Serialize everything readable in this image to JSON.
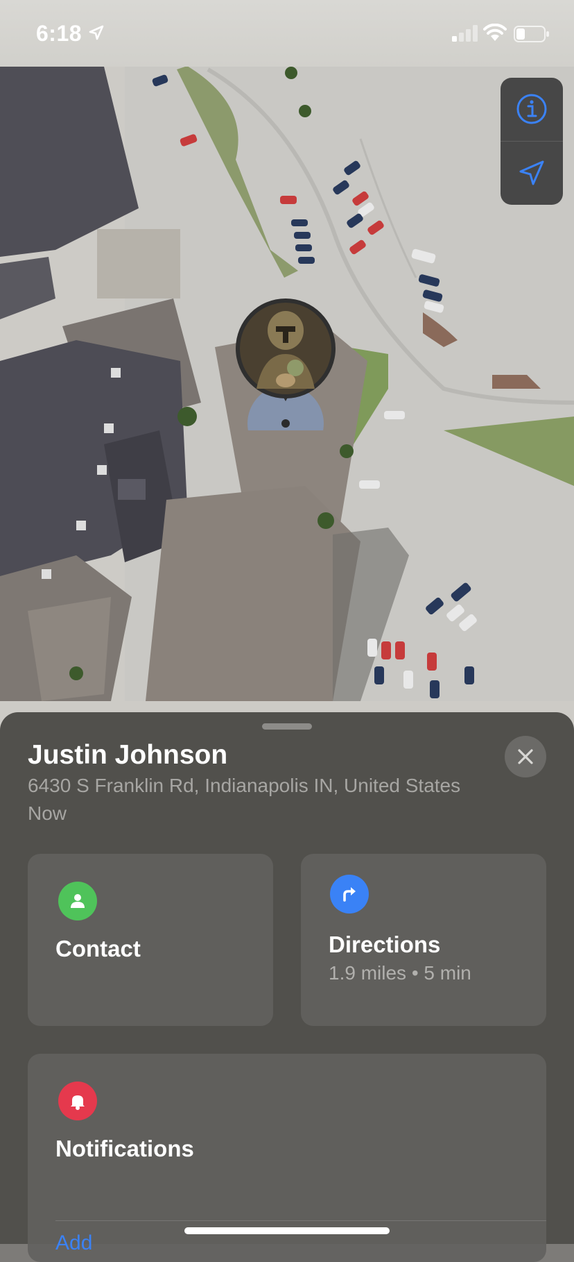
{
  "status_bar": {
    "time": "6:18"
  },
  "map": {
    "controls": {
      "info_icon": "info-circle-icon",
      "locate_icon": "location-arrow-icon"
    },
    "pin": {
      "avatar": "person-avatar-photo"
    }
  },
  "person": {
    "name": "Justin Johnson",
    "address": "6430 S Franklin Rd, Indianapolis IN, United States",
    "last_seen": "Now"
  },
  "actions": {
    "contact": {
      "label": "Contact",
      "icon": "person-icon",
      "color": "#4fc35a"
    },
    "directions": {
      "label": "Directions",
      "detail": "1.9 miles • 5 min",
      "icon": "turn-right-arrow-icon",
      "color": "#3a82f6"
    }
  },
  "notifications": {
    "title": "Notifications",
    "icon": "bell-icon",
    "color": "#e5394d",
    "add_label": "Add"
  },
  "colors": {
    "accent": "#3b82f6",
    "sheet_bg": "#4c4b48"
  }
}
